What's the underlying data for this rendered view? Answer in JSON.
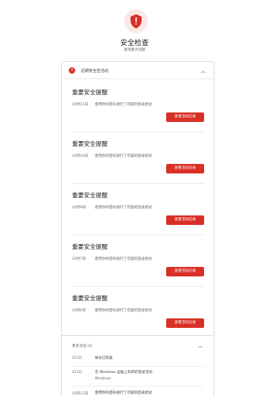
{
  "header": {
    "title": "安全检查",
    "subtitle": "发现重大问题"
  },
  "recent_activity": {
    "title": "近期安全性活动",
    "alert_count": "!",
    "alerts": [
      {
        "title": "重要安全提醒",
        "date": "10月11日",
        "description": "使用你的密码进行了可疑的登录尝试",
        "button": "查看活动记录"
      },
      {
        "title": "重要安全提醒",
        "date": "10月10日",
        "description": "使用你的密码进行了可疑的登录尝试",
        "button": "查看活动记录"
      },
      {
        "title": "重要安全提醒",
        "date": "10月8日",
        "description": "使用你的密码进行了可疑的登录尝试",
        "button": "查看活动记录"
      },
      {
        "title": "重要安全提醒",
        "date": "10月7日",
        "description": "使用你的密码进行了可疑的登录尝试",
        "button": "查看活动记录"
      },
      {
        "title": "重要安全提醒",
        "date": "10月6日",
        "description": "使用你的密码进行了可疑的登录尝试",
        "button": "查看活动记录"
      }
    ]
  },
  "more_activity": {
    "title": "更多活动 (4)",
    "events": [
      {
        "time": "21:01",
        "text": "帐号已恢复",
        "detail": ""
      },
      {
        "time": "21:01",
        "text": "在 Windows 设备上有新的登录活动",
        "detail": "Windows"
      },
      {
        "time": "10月12日",
        "text": "使用你的密码进行了可疑的登录尝试",
        "detail": ""
      }
    ]
  },
  "colors": {
    "accent_red": "#d93025",
    "shield_bg": "#fce8e6"
  }
}
